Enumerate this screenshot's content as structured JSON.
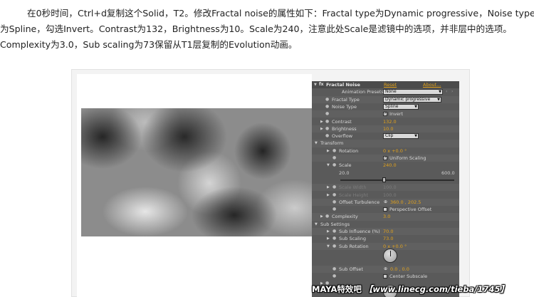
{
  "article": {
    "line1": "在0秒时间，Ctrl+d复制这个Solid，T2。修改Fractal noise的属性如下：Fractal type为Dynamic progressive，Noise type",
    "line2": "为Spline，勾选Invert。Contrast为132，Brightness为10。Scale为240，注意此处Scale是滤镜中的选项，并非层中的选项。",
    "line3": "Complexity为3.0，Sub scaling为73保留从T1层复制的Evolution动画。"
  },
  "panel": {
    "effect_name": "Fractal Noise",
    "reset_link": "Reset",
    "about_link": "About...",
    "animation_presets": {
      "label": "Animation Presets:",
      "value": "None"
    },
    "fractal_type": {
      "label": "Fractal Type",
      "value": "Dynamic progressive"
    },
    "noise_type": {
      "label": "Noise Type",
      "value": "Spline"
    },
    "invert": {
      "label": "Invert",
      "checked": true,
      "mark": "✓"
    },
    "contrast": {
      "label": "Contrast",
      "value": "132.0"
    },
    "brightness": {
      "label": "Brightness",
      "value": "10.0"
    },
    "overflow": {
      "label": "Overflow",
      "value": "Clip"
    },
    "transform": {
      "label": "Transform",
      "rotation": {
        "label": "Rotation",
        "value": "0 x +0.0 °"
      },
      "uniform_scaling": {
        "label": "Uniform Scaling",
        "checked": true,
        "mark": "✓"
      },
      "scale": {
        "label": "Scale",
        "value": "240.0",
        "min": "20.0",
        "max": "600.0",
        "fraction": 0.378
      },
      "scale_width": {
        "label": "Scale Width",
        "value": "100.0"
      },
      "scale_height": {
        "label": "Scale Height",
        "value": "100.0"
      },
      "offset_turbulence": {
        "label": "Offset Turbulence",
        "value": "360.0 , 202.5"
      },
      "perspective_offset": {
        "label": "Perspective Offset",
        "checked": false
      }
    },
    "complexity": {
      "label": "Complexity",
      "value": "3.0"
    },
    "sub_settings": {
      "label": "Sub Settings",
      "sub_influence": {
        "label": "Sub Influence (%)",
        "value": "70.0"
      },
      "sub_scaling": {
        "label": "Sub Scaling",
        "value": "73.0"
      },
      "sub_rotation": {
        "label": "Sub Rotation",
        "value": "0 x +0.0 °"
      },
      "sub_offset": {
        "label": "Sub Offset",
        "value": "0.0 , 0.0"
      },
      "center_subscale": {
        "label": "Center Subscale",
        "checked": false
      }
    }
  },
  "watermark": {
    "brand": "MAYA特效吧",
    "url": "【www.linecg.com/tieba/1745】"
  },
  "colors": {
    "panel_bg": "#5a5a5a",
    "value_orange": "#e2a21b",
    "text_light": "#d8d8d8"
  },
  "icons": {
    "twirl_open": "▼",
    "twirl_closed": "▶",
    "stopwatch": "●",
    "effect_fx": "fx"
  }
}
